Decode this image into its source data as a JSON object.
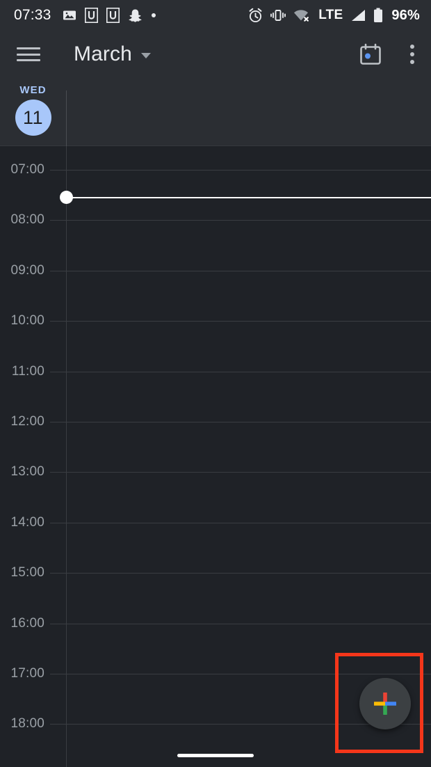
{
  "status_bar": {
    "clock": "07:33",
    "battery_percent": "96%",
    "network_type": "LTE",
    "left_icons": [
      {
        "name": "photo-icon",
        "label": "Screenshot"
      },
      {
        "name": "notification-u-icon-1",
        "label": "U"
      },
      {
        "name": "notification-u-icon-2",
        "label": "U"
      },
      {
        "name": "snapchat-icon",
        "label": "Snapchat"
      },
      {
        "name": "more-notifications-dot-icon",
        "label": "More notifications"
      }
    ],
    "right_icons": [
      {
        "name": "alarm-clock-icon",
        "label": "Alarm set"
      },
      {
        "name": "vibrate-icon",
        "label": "Vibrate mode"
      },
      {
        "name": "wifi-off-icon",
        "label": "Wi-Fi disconnected"
      },
      {
        "name": "signal-bars-icon",
        "label": "Signal strength"
      },
      {
        "name": "battery-icon",
        "label": "Battery"
      }
    ]
  },
  "toolbar": {
    "menu_label": "Open navigation drawer",
    "title": "March",
    "dropdown_label": "Change view",
    "today_label": "Go to today",
    "overflow_label": "More options"
  },
  "day_header": {
    "day_of_week": "WED",
    "day_number": "11"
  },
  "calendar_grid": {
    "hours": [
      "07:00",
      "08:00",
      "09:00",
      "10:00",
      "11:00",
      "12:00",
      "13:00",
      "14:00",
      "15:00",
      "16:00",
      "17:00",
      "18:00"
    ],
    "current_time_label": "07:33",
    "events": []
  },
  "fab": {
    "label": "Create new event",
    "icon": "plus-icon",
    "colors": {
      "top": "#ea4335",
      "right": "#4285f4",
      "bottom": "#34a853",
      "left": "#fbbc05"
    }
  },
  "highlight": {
    "color": "#f4361a",
    "target": "create-event-fab"
  },
  "theme": {
    "background": "#1f2227",
    "surface": "#2b2e33",
    "accent": "#a8c7fa",
    "text_primary": "#e8eaed",
    "text_secondary": "#9aa0a6",
    "gridline": "#3a3d42"
  }
}
